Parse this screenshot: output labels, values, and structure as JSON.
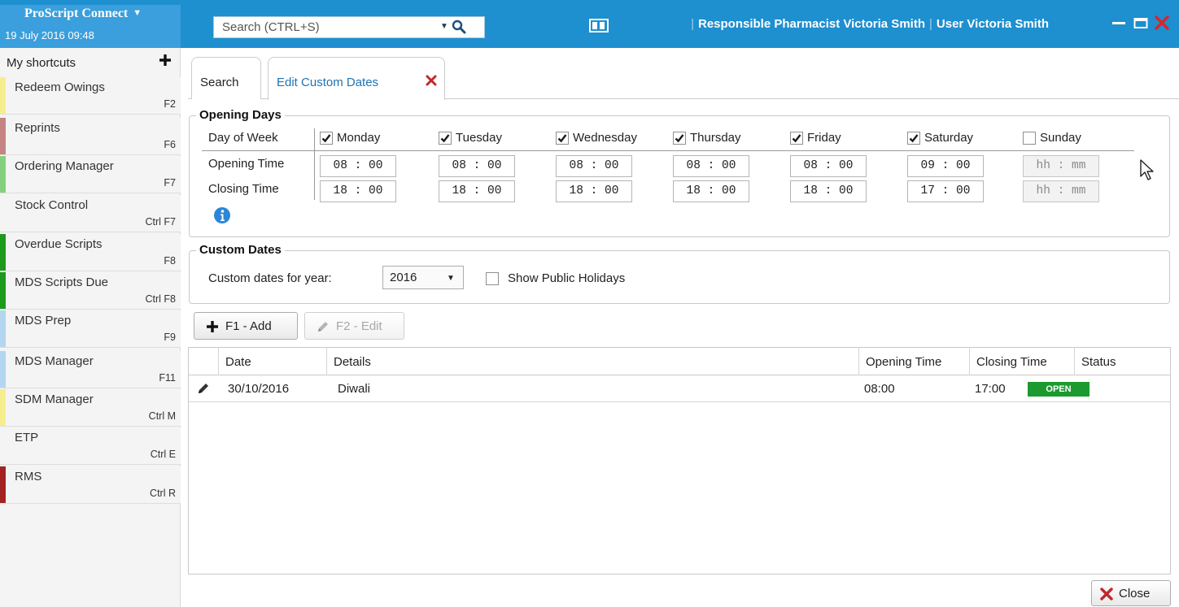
{
  "app": {
    "title": "ProScript Connect",
    "datetime": "19 July 2016 09:48"
  },
  "search": {
    "placeholder": "Search (CTRL+S)"
  },
  "header": {
    "pharmacist": "Responsible Pharmacist Victoria Smith",
    "user": "User Victoria Smith"
  },
  "sidebar": {
    "title": "My shortcuts",
    "items": [
      {
        "label": "Redeem Owings",
        "key": "F2",
        "color": "#f6ee8c"
      },
      {
        "label": "Reprints",
        "key": "F6",
        "color": "#c58383"
      },
      {
        "label": "Ordering Manager",
        "key": "F7",
        "color": "#83d07f"
      },
      {
        "label": "Stock Control",
        "key": "Ctrl F7",
        "color": "#f4f4f4"
      },
      {
        "label": "Overdue Scripts",
        "key": "F8",
        "color": "#1b9a1b"
      },
      {
        "label": "MDS Scripts Due",
        "key": "Ctrl F8",
        "color": "#1b9a1b"
      },
      {
        "label": "MDS Prep",
        "key": "F9",
        "color": "#b3d7ef"
      },
      {
        "label": "MDS Manager",
        "key": "F11",
        "color": "#b3d7ef"
      },
      {
        "label": "SDM Manager",
        "key": "Ctrl M",
        "color": "#f6ee8c"
      },
      {
        "label": "ETP",
        "key": "Ctrl E",
        "color": "#f4f4f4"
      },
      {
        "label": "RMS",
        "key": "Ctrl R",
        "color": "#a32222"
      }
    ]
  },
  "tabs": {
    "search": "Search",
    "edit": "Edit Custom Dates"
  },
  "opening_days": {
    "title": "Opening Days",
    "row_labels": {
      "day": "Day of Week",
      "open": "Opening Time",
      "close": "Closing Time"
    },
    "days": [
      {
        "name": "Monday",
        "checked": true,
        "open": "08 : 00",
        "close": "18 : 00"
      },
      {
        "name": "Tuesday",
        "checked": true,
        "open": "08 : 00",
        "close": "18 : 00"
      },
      {
        "name": "Wednesday",
        "checked": true,
        "open": "08 : 00",
        "close": "18 : 00"
      },
      {
        "name": "Thursday",
        "checked": true,
        "open": "08 : 00",
        "close": "18 : 00"
      },
      {
        "name": "Friday",
        "checked": true,
        "open": "08 : 00",
        "close": "18 : 00"
      },
      {
        "name": "Saturday",
        "checked": true,
        "open": "09 : 00",
        "close": "17 : 00"
      },
      {
        "name": "Sunday",
        "checked": false,
        "open": "hh : mm",
        "close": "hh : mm"
      }
    ]
  },
  "custom_dates": {
    "title": "Custom Dates",
    "year_label": "Custom dates for year:",
    "year": "2016",
    "holidays_label": "Show Public Holidays",
    "holidays_checked": false
  },
  "toolbar": {
    "add": "F1 - Add",
    "edit": "F2 - Edit"
  },
  "grid": {
    "columns": [
      "Date",
      "Details",
      "Opening Time",
      "Closing Time",
      "Status"
    ],
    "rows": [
      {
        "date": "30/10/2016",
        "details": "Diwali",
        "open": "08:00",
        "close": "17:00",
        "status": "OPEN"
      }
    ]
  },
  "footer": {
    "close": "Close"
  },
  "colors": {
    "accent": "#1e8fcf",
    "status_open": "#1c9a2f",
    "close_red": "#c0282d"
  }
}
